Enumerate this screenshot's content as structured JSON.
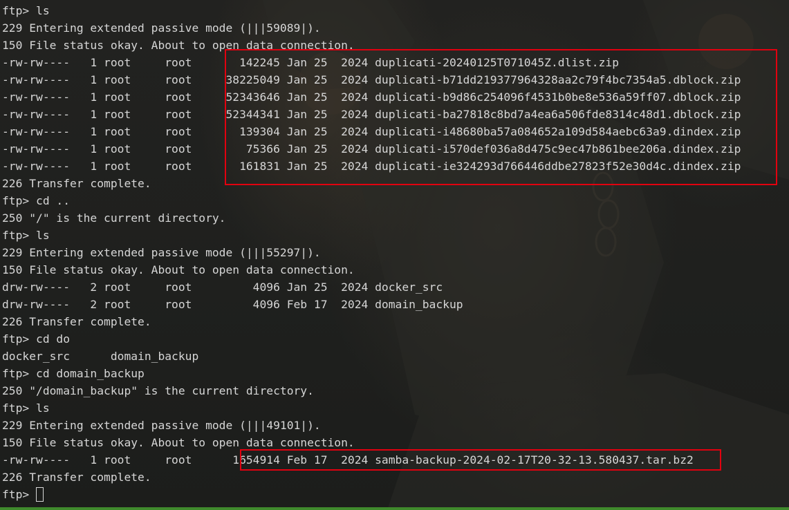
{
  "terminal": {
    "lines": [
      "ftp> ls",
      "229 Entering extended passive mode (|||59089|).",
      "150 File status okay. About to open data connection.",
      "-rw-rw----   1 root     root       142245 Jan 25  2024 duplicati-20240125T071045Z.dlist.zip",
      "-rw-rw----   1 root     root     38225049 Jan 25  2024 duplicati-b71dd219377964328aa2c79f4bc7354a5.dblock.zip",
      "-rw-rw----   1 root     root     52343646 Jan 25  2024 duplicati-b9d86c254096f4531b0be8e536a59ff07.dblock.zip",
      "-rw-rw----   1 root     root     52344341 Jan 25  2024 duplicati-ba27818c8bd7a4ea6a506fde8314c48d1.dblock.zip",
      "-rw-rw----   1 root     root       139304 Jan 25  2024 duplicati-i48680ba57a084652a109d584aebc63a9.dindex.zip",
      "-rw-rw----   1 root     root        75366 Jan 25  2024 duplicati-i570def036a8d475c9ec47b861bee206a.dindex.zip",
      "-rw-rw----   1 root     root       161831 Jan 25  2024 duplicati-ie324293d766446ddbe27823f52e30d4c.dindex.zip",
      "226 Transfer complete.",
      "ftp> cd ..",
      "250 \"/\" is the current directory.",
      "ftp> ls",
      "229 Entering extended passive mode (|||55297|).",
      "150 File status okay. About to open data connection.",
      "drw-rw----   2 root     root         4096 Jan 25  2024 docker_src",
      "drw-rw----   2 root     root         4096 Feb 17  2024 domain_backup",
      "226 Transfer complete.",
      "ftp> cd do",
      "docker_src      domain_backup",
      "ftp> cd domain_backup",
      "250 \"/domain_backup\" is the current directory.",
      "ftp> ls",
      "229 Entering extended passive mode (|||49101|).",
      "150 File status okay. About to open data connection.",
      "-rw-rw----   1 root     root      1654914 Feb 17  2024 samba-backup-2024-02-17T20-32-13.580437.tar.bz2",
      "226 Transfer complete."
    ],
    "prompt": "ftp> "
  },
  "colors": {
    "text": "#d6d6d6",
    "highlight": "#e2000f",
    "background": "#1f201e",
    "accent_strip": "#3f8a2c"
  }
}
